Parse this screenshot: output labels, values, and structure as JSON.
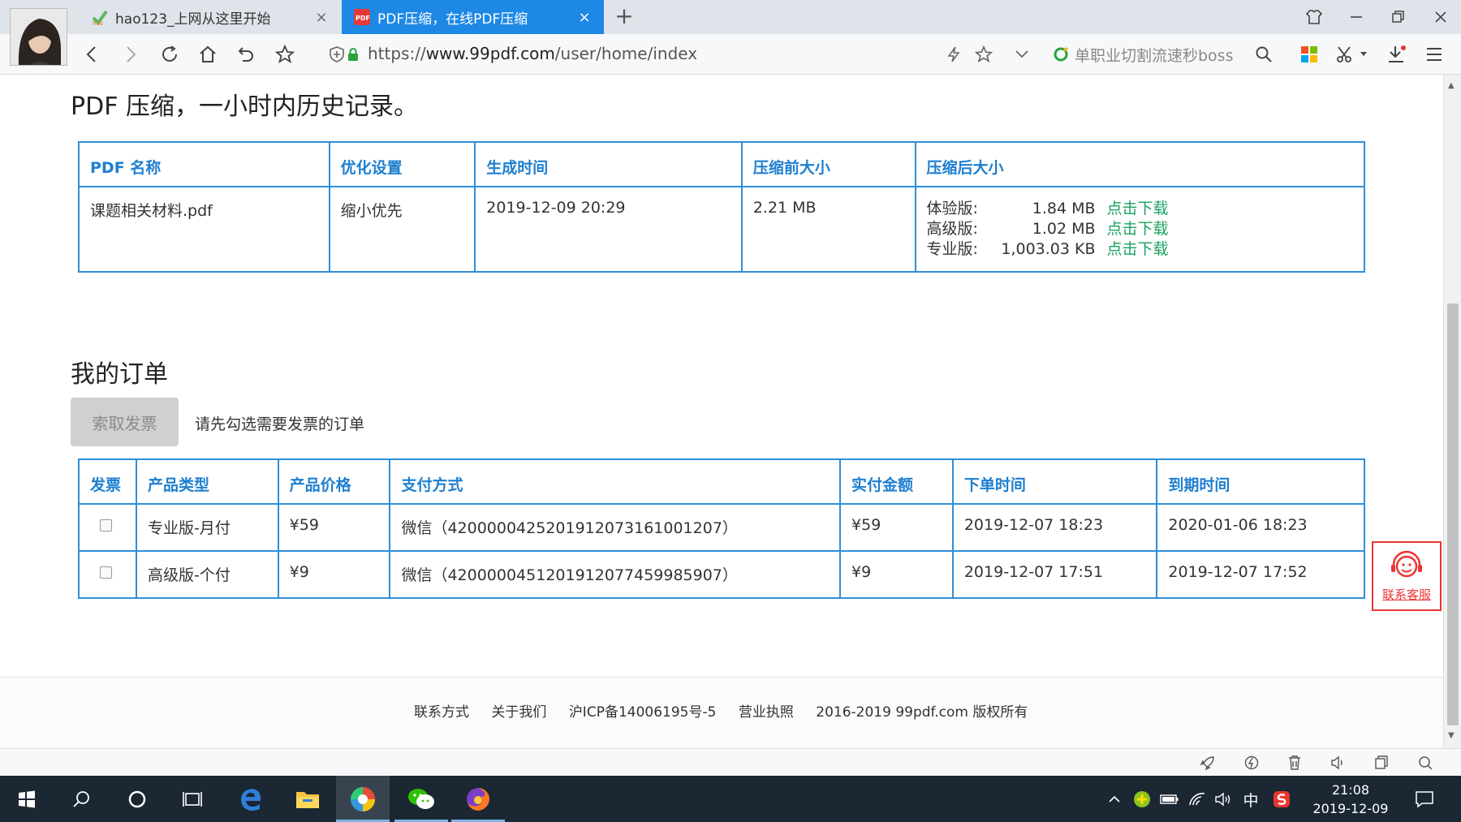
{
  "browser": {
    "tabs": [
      {
        "label": "hao123_上网从这里开始",
        "active": false
      },
      {
        "label": "PDF压缩，在线PDF压缩",
        "active": true
      }
    ],
    "new_tab": "+",
    "url_prefix": "https://",
    "url_domain": "www.99pdf.com",
    "url_path": "/user/home/index",
    "search_text": "单职业切割流速秒boss"
  },
  "history": {
    "title": "PDF 压缩，一小时内历史记录。",
    "headers": [
      "PDF 名称",
      "优化设置",
      "生成时间",
      "压缩前大小",
      "压缩后大小"
    ],
    "row": {
      "name": "课题相关材料.pdf",
      "setting": "缩小优先",
      "time": "2019-12-09 20:29",
      "before": "2.21 MB",
      "sizes": [
        {
          "label": "体验版:",
          "value": "1.84 MB",
          "link": "点击下载"
        },
        {
          "label": "高级版:",
          "value": "1.02 MB",
          "link": "点击下载"
        },
        {
          "label": "专业版:",
          "value": "1,003.03 KB",
          "link": "点击下载"
        }
      ]
    }
  },
  "orders": {
    "title": "我的订单",
    "invoice_button": "索取发票",
    "invoice_hint": "请先勾选需要发票的订单",
    "headers": [
      "发票",
      "产品类型",
      "产品价格",
      "支付方式",
      "实付金额",
      "下单时间",
      "到期时间"
    ],
    "rows": [
      {
        "product": "专业版-月付",
        "price": "¥59",
        "payment": "微信（4200000425201912073161001207）",
        "paid": "¥59",
        "ordered": "2019-12-07 18:23",
        "expires": "2020-01-06 18:23"
      },
      {
        "product": "高级版-个付",
        "price": "¥9",
        "payment": "微信（4200000451201912077459985907）",
        "paid": "¥9",
        "ordered": "2019-12-07 17:51",
        "expires": "2019-12-07 17:52"
      }
    ]
  },
  "footer": {
    "links": [
      "联系方式",
      "关于我们",
      "沪ICP备14006195号-5",
      "营业执照",
      "2016-2019 99pdf.com 版权所有"
    ]
  },
  "service": {
    "label": "联系客服"
  },
  "taskbar": {
    "ime": "中",
    "time": "21:08",
    "date": "2019-12-09"
  },
  "colors": {
    "accent": "#1e88e5",
    "table_border": "#2f8fd8",
    "download_link": "#1aa260",
    "service_red": "#e33333",
    "taskbar": "#1b2733"
  }
}
